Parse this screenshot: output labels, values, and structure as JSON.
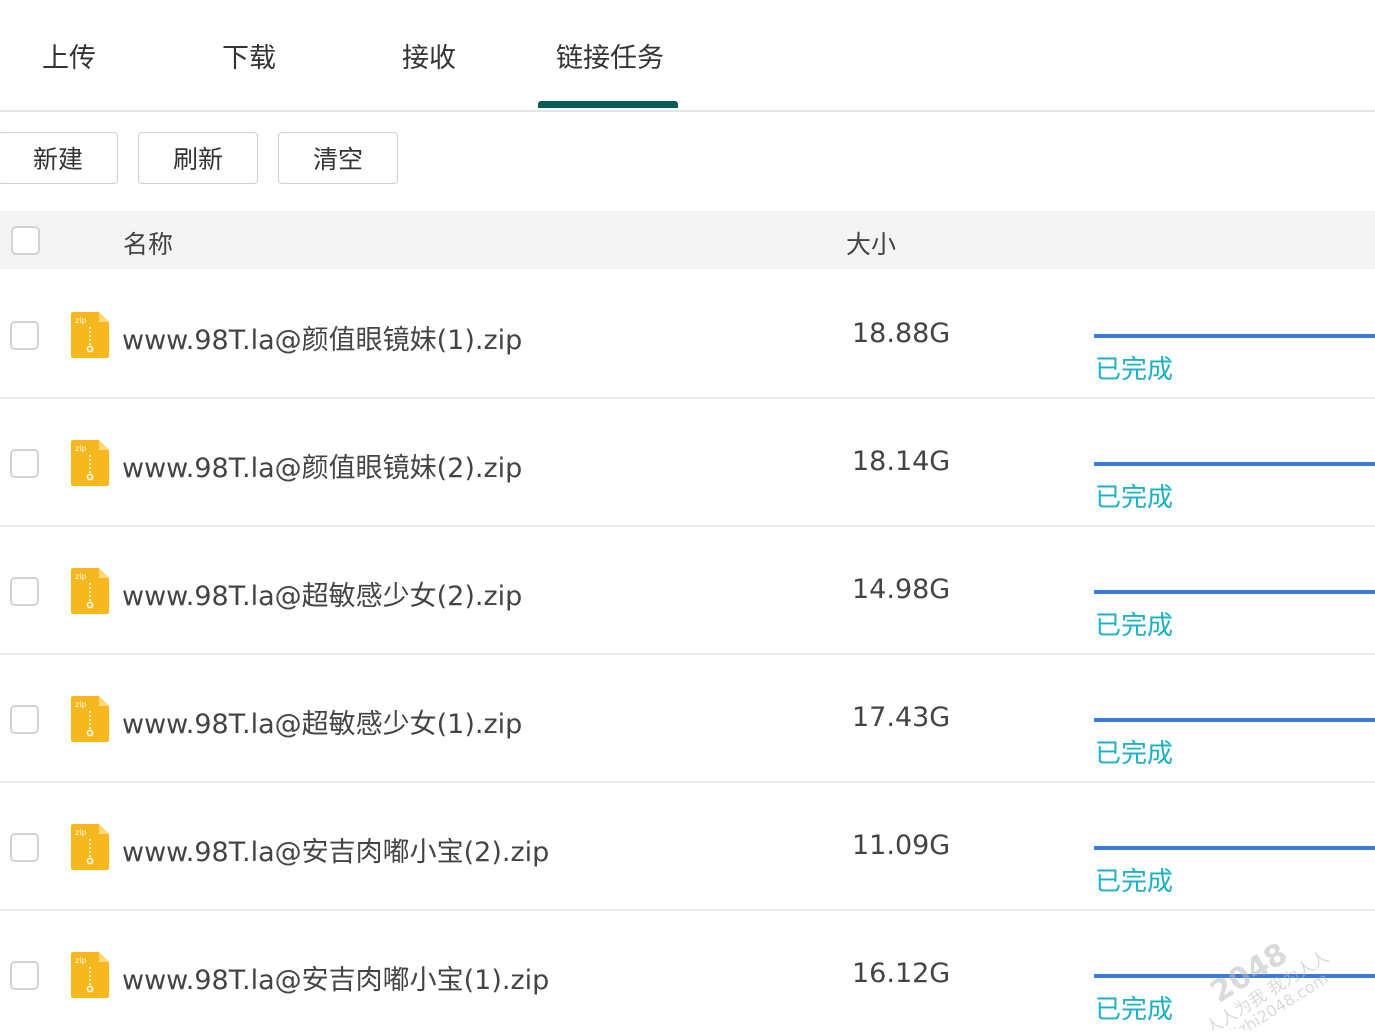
{
  "tabs": [
    {
      "label": "上传"
    },
    {
      "label": "下载"
    },
    {
      "label": "接收"
    },
    {
      "label": "链接任务",
      "active": true
    }
  ],
  "toolbar": {
    "new_label": "新建",
    "refresh_label": "刷新",
    "clear_label": "清空"
  },
  "table": {
    "headers": {
      "name": "名称",
      "size": "大小"
    },
    "rows": [
      {
        "name": "www.98T.la@颜值眼镜妹(1).zip",
        "size": "18.88G",
        "status": "已完成",
        "icon": "zip-file-icon",
        "icon_text": "zip",
        "progress": 1.0
      },
      {
        "name": "www.98T.la@颜值眼镜妹(2).zip",
        "size": "18.14G",
        "status": "已完成",
        "icon": "zip-file-icon",
        "icon_text": "zip",
        "progress": 1.0
      },
      {
        "name": "www.98T.la@超敏感少女(2).zip",
        "size": "14.98G",
        "status": "已完成",
        "icon": "zip-file-icon",
        "icon_text": "zip",
        "progress": 1.0
      },
      {
        "name": "www.98T.la@超敏感少女(1).zip",
        "size": "17.43G",
        "status": "已完成",
        "icon": "zip-file-icon",
        "icon_text": "zip",
        "progress": 1.0
      },
      {
        "name": "www.98T.la@安吉肉嘟小宝(2).zip",
        "size": "11.09G",
        "status": "已完成",
        "icon": "zip-file-icon",
        "icon_text": "zip",
        "progress": 1.0
      },
      {
        "name": "www.98T.la@安吉肉嘟小宝(1).zip",
        "size": "16.12G",
        "status": "已完成",
        "icon": "zip-file-icon",
        "icon_text": "zip",
        "progress": 1.0
      }
    ]
  },
  "watermark": {
    "line1": "2048",
    "line2": "人人为我 我为人人",
    "line3": "dizhi2048.com"
  },
  "colors": {
    "tab_indicator": "#0b5b57",
    "progress": "#3b7be0",
    "status": "#1cb0c5",
    "zip_icon": "#f6b81c"
  }
}
